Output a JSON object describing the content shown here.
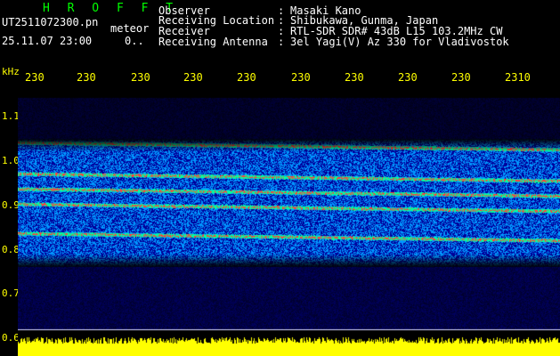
{
  "app_title": "H R O F F T",
  "file_name": "UT2511072300.pn",
  "meteor_label": "meteor",
  "datetime": "25.11.07 23:00",
  "meteor_count": "0..",
  "info": {
    "observer": {
      "label": "Observer",
      "value": "Masaki Kano"
    },
    "location": {
      "label": "Receiving Location",
      "value": "Shibukawa, Gunma, Japan"
    },
    "receiver": {
      "label": "Receiver",
      "value": "RTL-SDR SDR# 43dB L15 103.2MHz CW"
    },
    "antenna": {
      "label": "Receiving Antenna",
      "value": "3el Yagi(V) Az 330 for Vladivostok"
    },
    "separator": ":"
  },
  "y_axis": {
    "unit": "kHz",
    "ticks": [
      "1.1",
      "1.0",
      "0.9",
      "0.8",
      "0.7",
      "0.6"
    ]
  },
  "x_axis": {
    "ticks": [
      "230",
      "230",
      "230",
      "230",
      "230",
      "230",
      "230",
      "230",
      "230",
      "2310"
    ]
  },
  "colors": {
    "background": "#000000",
    "spectrum_low": "#00008b",
    "spectrum_mid": "#00bfff",
    "spectrum_high": "#ff3030",
    "signal_bar": "#ffff00",
    "text_primary": "#ffffff",
    "text_axis": "#ffff00",
    "title_green": "#00ff00"
  }
}
